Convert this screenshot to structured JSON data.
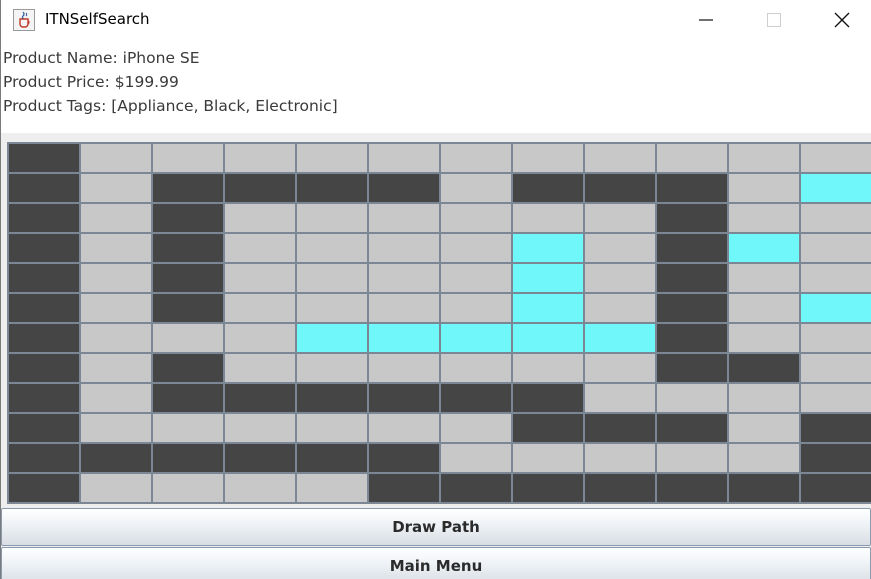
{
  "window": {
    "title": "ITNSelfSearch",
    "icon": "java-cup-icon",
    "controls": [
      "minimize-icon",
      "maximize-icon",
      "close-icon"
    ]
  },
  "product": {
    "name_line": "Product Name: iPhone SE",
    "price_line": "Product Price: $199.99",
    "tags_line": "Product Tags: [Appliance, Black, Electronic]"
  },
  "grid": {
    "rows": 12,
    "cols": 12,
    "colors": {
      "wall": "#454545",
      "open": "#c8c8c8",
      "path": "#6ff7f9"
    },
    "cells": [
      "WOOOOOOOOOOO",
      "WOWWWWOWWWOP",
      "WOWOOOOOOWOO",
      "WOWOOOOPOWPO",
      "WOWOOOOPOWOO",
      "WOWOOOOPOWOP",
      "WOOOPPPPPWOO",
      "WOWOOOOOOWWO",
      "WOWWWWWWOOOO",
      "WOOOOOOWWWOW",
      "WWWWWWOOOOOW",
      "WOOOOWWWWWWW"
    ]
  },
  "buttons": {
    "draw_path": "Draw Path",
    "main_menu": "Main Menu"
  }
}
